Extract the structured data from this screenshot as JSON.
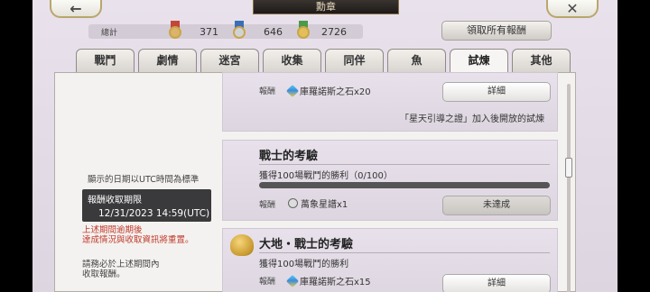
{
  "header": {
    "back_icon": "←",
    "title": "勳章",
    "close_icon": "✕"
  },
  "totals": {
    "label": "總計",
    "medals": [
      {
        "icon": "bronze-medal-icon",
        "count": "371",
        "color": "#c3463a"
      },
      {
        "icon": "silver-medal-icon",
        "count": "646",
        "color": "#3a6fb5"
      },
      {
        "icon": "gold-medal-icon",
        "count": "2726",
        "color": "#4a9a4a"
      }
    ]
  },
  "claim_all_label": "領取所有報酬",
  "tabs": [
    "戰鬥",
    "劇情",
    "迷宮",
    "收集",
    "同伴",
    "魚",
    "試煉",
    "其他"
  ],
  "active_tab": "試煉",
  "side": {
    "timezone_note": "顯示的日期以UTC時間為標準",
    "deadline_label": "報酬收取期限",
    "deadline_value": "12/31/2023 14:59(UTC)",
    "warning_line1": "上述期間逾期後",
    "warning_line2": "達成情況與收取資訊將重置。",
    "note_line1": "請務必於上述期間內",
    "note_line2": "收取報酬。"
  },
  "cards": [
    {
      "reward_label": "報酬",
      "reward": "庫羅諾斯之石x20",
      "button": "詳細",
      "note": "「星天引導之證」加入後開放的試煉"
    },
    {
      "title": "戰士的考驗",
      "desc": "獲得100場戰鬥的勝利（0/100）",
      "progress": 0,
      "reward_label": "報酬",
      "reward": "萬象星譜x1",
      "button": "未達成"
    },
    {
      "title": "大地・戰士的考驗",
      "desc": "獲得100場戰鬥的勝利",
      "reward_label": "報酬",
      "reward": "庫羅諾斯之石x15",
      "button": "詳細"
    }
  ],
  "colors": {
    "warning": "#c0392b",
    "panel": "#f4f2f0",
    "accent_border": "#b9a66c"
  }
}
